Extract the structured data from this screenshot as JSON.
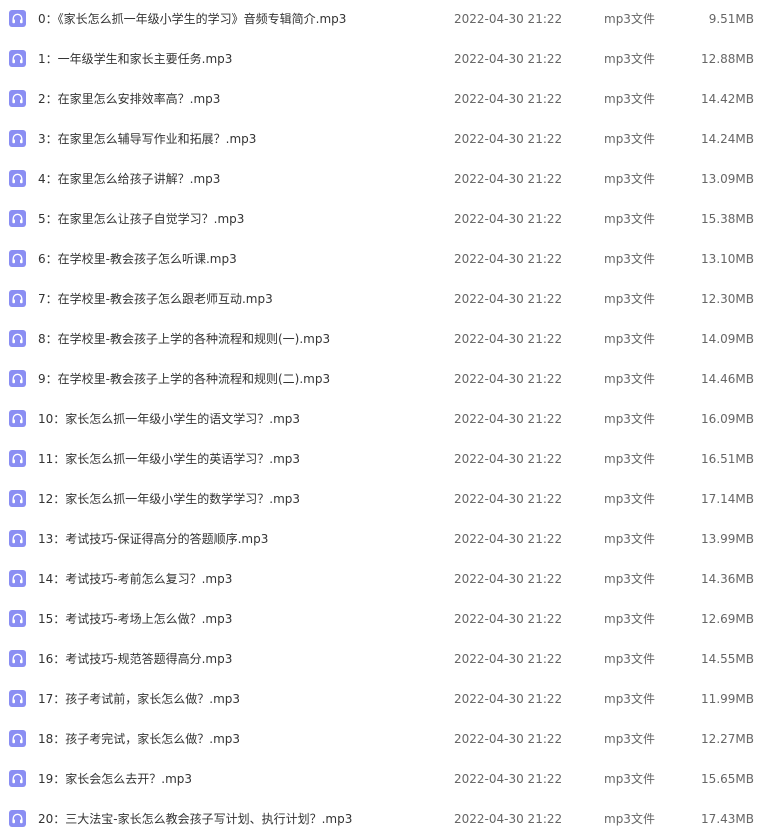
{
  "icon_name": "audio-file-icon",
  "icon_color": "#8a8ef3",
  "files": [
    {
      "name": "0：《家长怎么抓一年级小学生的学习》音频专辑简介.mp3",
      "modified": "2022-04-30 21:22",
      "type": "mp3文件",
      "size": "9.51MB"
    },
    {
      "name": "1：一年级学生和家长主要任务.mp3",
      "modified": "2022-04-30 21:22",
      "type": "mp3文件",
      "size": "12.88MB"
    },
    {
      "name": "2：在家里怎么安排效率高？.mp3",
      "modified": "2022-04-30 21:22",
      "type": "mp3文件",
      "size": "14.42MB"
    },
    {
      "name": "3：在家里怎么辅导写作业和拓展？.mp3",
      "modified": "2022-04-30 21:22",
      "type": "mp3文件",
      "size": "14.24MB"
    },
    {
      "name": "4：在家里怎么给孩子讲解？.mp3",
      "modified": "2022-04-30 21:22",
      "type": "mp3文件",
      "size": "13.09MB"
    },
    {
      "name": "5：在家里怎么让孩子自觉学习？.mp3",
      "modified": "2022-04-30 21:22",
      "type": "mp3文件",
      "size": "15.38MB"
    },
    {
      "name": "6：在学校里-教会孩子怎么听课.mp3",
      "modified": "2022-04-30 21:22",
      "type": "mp3文件",
      "size": "13.10MB"
    },
    {
      "name": "7：在学校里-教会孩子怎么跟老师互动.mp3",
      "modified": "2022-04-30 21:22",
      "type": "mp3文件",
      "size": "12.30MB"
    },
    {
      "name": "8：在学校里-教会孩子上学的各种流程和规则(一).mp3",
      "modified": "2022-04-30 21:22",
      "type": "mp3文件",
      "size": "14.09MB"
    },
    {
      "name": "9：在学校里-教会孩子上学的各种流程和规则(二).mp3",
      "modified": "2022-04-30 21:22",
      "type": "mp3文件",
      "size": "14.46MB"
    },
    {
      "name": "10：家长怎么抓一年级小学生的语文学习？.mp3",
      "modified": "2022-04-30 21:22",
      "type": "mp3文件",
      "size": "16.09MB"
    },
    {
      "name": "11：家长怎么抓一年级小学生的英语学习？.mp3",
      "modified": "2022-04-30 21:22",
      "type": "mp3文件",
      "size": "16.51MB"
    },
    {
      "name": "12：家长怎么抓一年级小学生的数学学习？.mp3",
      "modified": "2022-04-30 21:22",
      "type": "mp3文件",
      "size": "17.14MB"
    },
    {
      "name": "13：考试技巧-保证得高分的答题顺序.mp3",
      "modified": "2022-04-30 21:22",
      "type": "mp3文件",
      "size": "13.99MB"
    },
    {
      "name": "14：考试技巧-考前怎么复习？.mp3",
      "modified": "2022-04-30 21:22",
      "type": "mp3文件",
      "size": "14.36MB"
    },
    {
      "name": "15：考试技巧-考场上怎么做？.mp3",
      "modified": "2022-04-30 21:22",
      "type": "mp3文件",
      "size": "12.69MB"
    },
    {
      "name": "16：考试技巧-规范答题得高分.mp3",
      "modified": "2022-04-30 21:22",
      "type": "mp3文件",
      "size": "14.55MB"
    },
    {
      "name": "17：孩子考试前，家长怎么做？.mp3",
      "modified": "2022-04-30 21:22",
      "type": "mp3文件",
      "size": "11.99MB"
    },
    {
      "name": "18：孩子考完试，家长怎么做？.mp3",
      "modified": "2022-04-30 21:22",
      "type": "mp3文件",
      "size": "12.27MB"
    },
    {
      "name": "19：家长会怎么去开？.mp3",
      "modified": "2022-04-30 21:22",
      "type": "mp3文件",
      "size": "15.65MB"
    },
    {
      "name": "20：三大法宝-家长怎么教会孩子写计划、执行计划？.mp3",
      "modified": "2022-04-30 21:22",
      "type": "mp3文件",
      "size": "17.43MB"
    }
  ]
}
